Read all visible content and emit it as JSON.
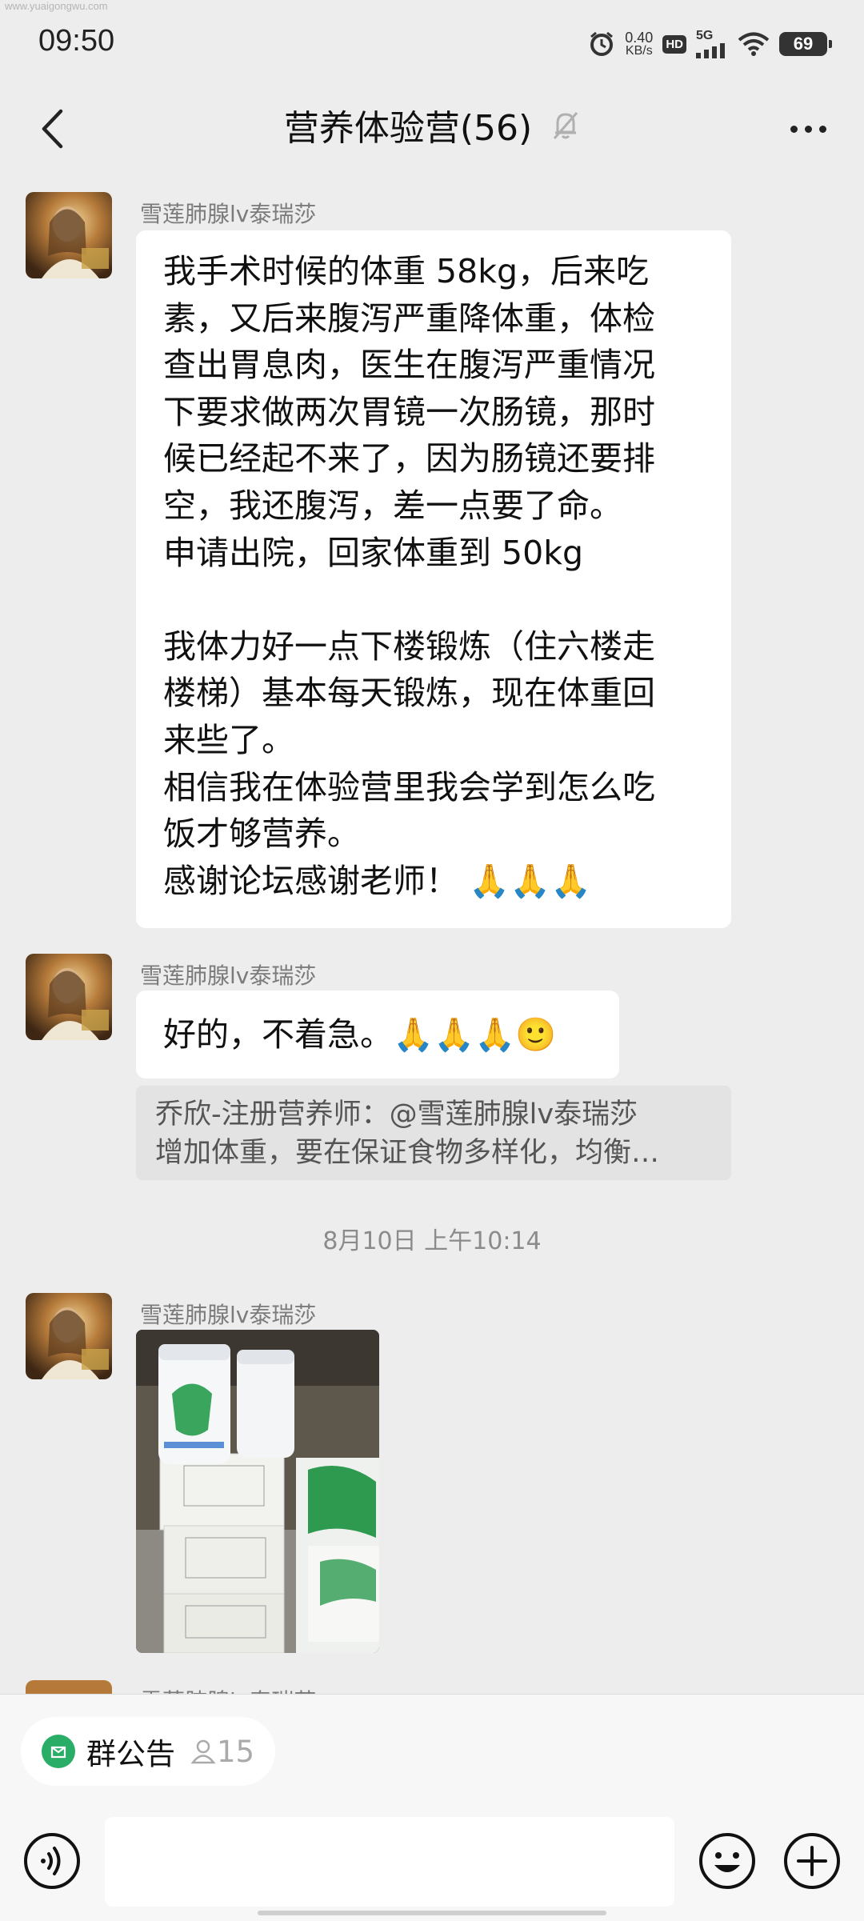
{
  "status_bar": {
    "watermark": "www.yuaigongwu.com",
    "time": "09:50",
    "net_speed_value": "0.40",
    "net_speed_unit": "KB/s",
    "hd": "HD",
    "network": "5G",
    "battery": "69"
  },
  "nav": {
    "title": "营养体验营(56)",
    "muted_icon": "bell-off-icon",
    "more_icon": "more-icon"
  },
  "messages": [
    {
      "sender": "雪莲肺腺lv泰瑞莎",
      "type": "text",
      "text": "我手术时候的体重 58kg，后来吃\n素，又后来腹泻严重降体重，体检\n查出胃息肉，医生在腹泻严重情况\n下要求做两次胃镜一次肠镜，那时\n候已经起不来了，因为肠镜还要排\n空，我还腹泻，差一点要了命。\n申请出院，回家体重到 50kg\n\n我体力好一点下楼锻炼（住六楼走\n楼梯）基本每天锻炼，现在体重回\n来些了。\n相信我在体验营里我会学到怎么吃\n饭才够营养。\n感谢论坛感谢老师！ 🙏🙏🙏"
    },
    {
      "sender": "雪莲肺腺lv泰瑞莎",
      "type": "text",
      "text": "好的，不着急。🙏🙏🙏🙂",
      "quote_line1": "乔欣-注册营养师：@雪莲肺腺lv泰瑞莎",
      "quote_line2": "增加体重，要在保证食物多样化，均衡…"
    },
    {
      "timestamp": "8月10日 上午10:14"
    },
    {
      "sender": "雪莲肺腺lv泰瑞莎",
      "type": "image"
    },
    {
      "sender": "雪莲肺腺lv泰瑞莎",
      "type": "partial"
    }
  ],
  "bottom": {
    "notice_label": "群公告",
    "notice_count": "15",
    "voice_icon": "voice-icon",
    "emoji_icon": "emoji-icon",
    "plus_icon": "plus-icon"
  }
}
